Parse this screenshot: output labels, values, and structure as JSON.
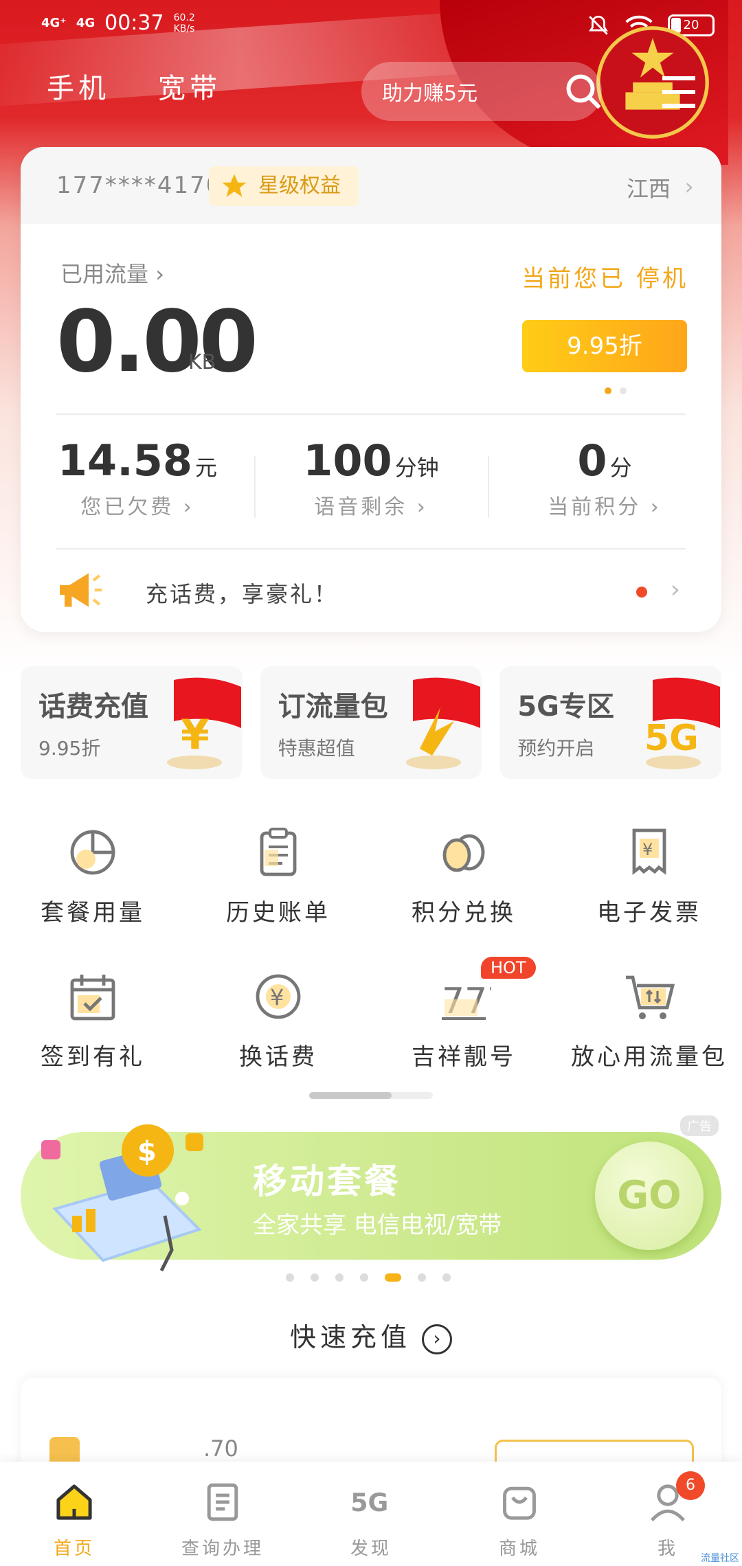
{
  "status_bar": {
    "net1": "4G⁺",
    "net2": "4G",
    "time": "00:37",
    "speed_value": "60.2",
    "speed_unit": "KB/s",
    "battery": "20"
  },
  "top_nav": {
    "tab_mobile": "手机",
    "tab_broadband": "宽带",
    "search_placeholder": "助力赚5元"
  },
  "account": {
    "phone": "177****4170",
    "badge": "星级权益",
    "region": "江西",
    "data_label": "已用流量",
    "data_value": "0.00",
    "data_unit": "KB",
    "status": "当前您已 停机",
    "discount": "9.95折",
    "stats": [
      {
        "value": "14.58",
        "unit": "元",
        "label": "您已欠费"
      },
      {
        "value": "100",
        "unit": "分钟",
        "label": "语音剩余"
      },
      {
        "value": "0",
        "unit": "分",
        "label": "当前积分"
      }
    ],
    "promo": "充话费，享豪礼！"
  },
  "tiles": [
    {
      "title": "话费充值",
      "sub": "9.95折"
    },
    {
      "title": "订流量包",
      "sub": "特惠超值"
    },
    {
      "title": "5G专区",
      "sub": "预约开启"
    }
  ],
  "grid": [
    {
      "label": "套餐用量",
      "icon": "pie-chart-icon"
    },
    {
      "label": "历史账单",
      "icon": "clipboard-icon"
    },
    {
      "label": "积分兑换",
      "icon": "coins-icon"
    },
    {
      "label": "电子发票",
      "icon": "invoice-icon"
    },
    {
      "label": "签到有礼",
      "icon": "calendar-check-icon"
    },
    {
      "label": "换话费",
      "icon": "yuan-circle-icon"
    },
    {
      "label": "吉祥靓号",
      "icon": "lucky-number-icon",
      "badge": "HOT"
    },
    {
      "label": "放心用流量包",
      "icon": "cart-icon"
    }
  ],
  "banner": {
    "ad_tag": "广告",
    "title": "移动套餐",
    "subtitle": "全家共享 电信电视/宽带",
    "go": "GO"
  },
  "quick_recharge": {
    "title": "快速充值",
    "number_fragment": ".70"
  },
  "bottom_nav": [
    {
      "label": "首页",
      "icon": "home-icon",
      "active": true
    },
    {
      "label": "查询办理",
      "icon": "document-icon"
    },
    {
      "label": "发现",
      "icon": "5g-icon"
    },
    {
      "label": "商城",
      "icon": "shopping-bag-icon"
    },
    {
      "label": "我",
      "icon": "user-icon",
      "badge": "6"
    }
  ],
  "corner_mark": "流量社区",
  "colors": {
    "brand_red": "#e0282a",
    "accent_orange": "#f2a71a",
    "banner_green": "#cde98d"
  }
}
